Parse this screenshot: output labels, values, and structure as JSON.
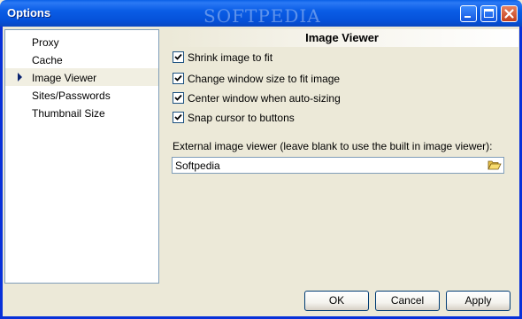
{
  "window": {
    "title": "Options",
    "watermark": "SOFTPEDIA",
    "controls": [
      "minimize-icon",
      "maximize-icon",
      "close-icon"
    ]
  },
  "sidebar": {
    "items": [
      {
        "label": "Proxy",
        "selected": false
      },
      {
        "label": "Cache",
        "selected": false
      },
      {
        "label": "Image Viewer",
        "selected": true
      },
      {
        "label": "Sites/Passwords",
        "selected": false
      },
      {
        "label": "Thumbnail Size",
        "selected": false
      }
    ]
  },
  "panel": {
    "title": "Image Viewer",
    "options": [
      {
        "label": "Shrink image to fit",
        "checked": true
      },
      {
        "label": "Change window size to fit image",
        "checked": true
      },
      {
        "label": "Center window when auto-sizing",
        "checked": true
      },
      {
        "label": "Snap cursor to buttons",
        "checked": true
      }
    ],
    "external_viewer_label": "External image viewer (leave blank to use the built in image viewer):",
    "external_viewer_value": "Softpedia",
    "browse_icon": "folder-open-icon"
  },
  "buttons": {
    "ok": "OK",
    "cancel": "Cancel",
    "apply": "Apply"
  }
}
